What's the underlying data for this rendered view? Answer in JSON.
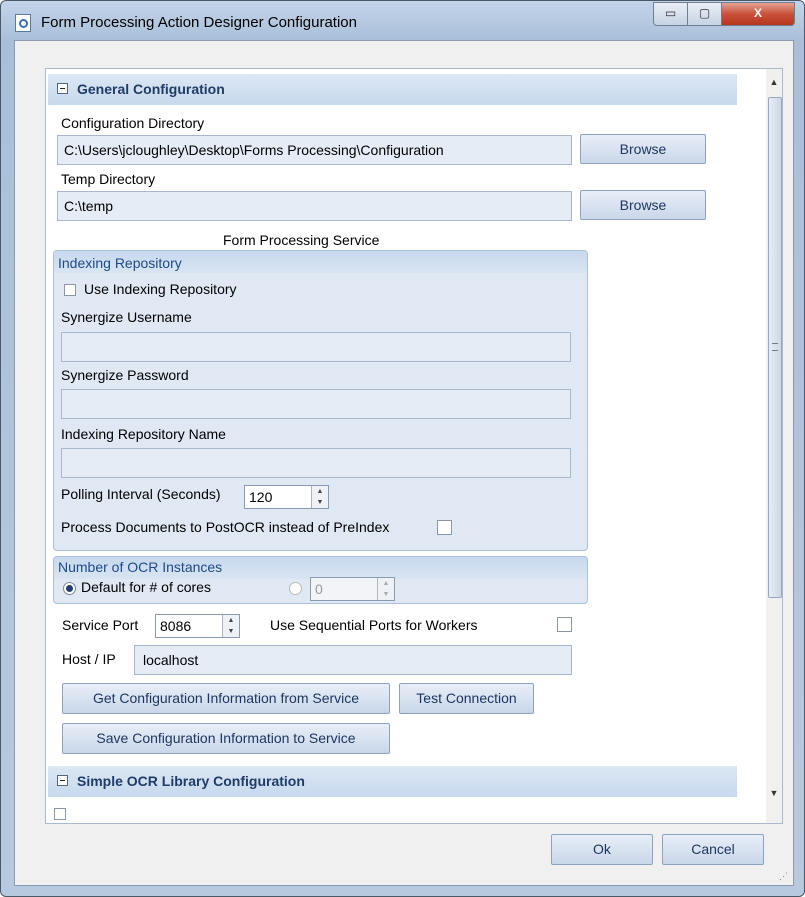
{
  "window": {
    "title": "Form Processing Action Designer Configuration",
    "min_glyph": "▭",
    "max_glyph": "▢",
    "close_glyph": "X"
  },
  "general": {
    "header": "General Configuration",
    "config_dir_label": "Configuration Directory",
    "config_dir_value": "C:\\Users\\jcloughley\\Desktop\\Forms Processing\\Configuration",
    "browse_label": "Browse",
    "temp_dir_label": "Temp Directory",
    "temp_dir_value": "C:\\temp",
    "service_label": "Form Processing Service"
  },
  "indexing": {
    "title": "Indexing Repository",
    "use_label": "Use Indexing Repository",
    "use_checked": false,
    "username_label": "Synergize Username",
    "username_value": "",
    "password_label": "Synergize Password",
    "password_value": "",
    "repo_name_label": "Indexing Repository Name",
    "repo_name_value": "",
    "polling_label": "Polling Interval (Seconds)",
    "polling_value": "120",
    "postocr_label": "Process Documents to PostOCR instead of PreIndex",
    "postocr_checked": false
  },
  "ocr_instances": {
    "title": "Number of OCR Instances",
    "default_label": "Default for # of cores",
    "default_selected": true,
    "custom_value": "0"
  },
  "service": {
    "port_label": "Service Port",
    "port_value": "8086",
    "sequential_label": "Use Sequential Ports for Workers",
    "sequential_checked": false,
    "host_label": "Host / IP",
    "host_value": "localhost",
    "get_config_label": "Get Configuration Information from Service",
    "test_connection_label": "Test Connection",
    "save_config_label": "Save Configuration Information to Service"
  },
  "simple_ocr": {
    "header": "Simple OCR Library Configuration"
  },
  "footer": {
    "ok_label": "Ok",
    "cancel_label": "Cancel"
  }
}
